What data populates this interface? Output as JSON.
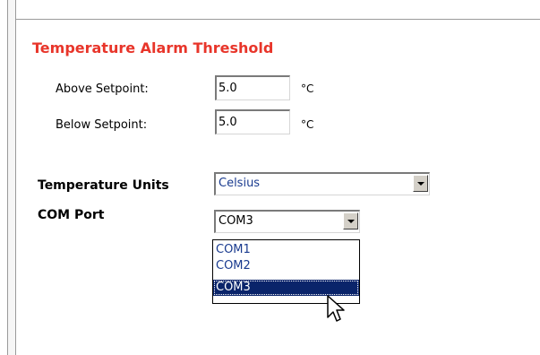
{
  "alarm": {
    "title": "Temperature Alarm Threshold",
    "above_label": "Above Setpoint:",
    "above_value": "5.0",
    "below_label": "Below Setpoint:",
    "below_value": "5.0",
    "unit": "°C"
  },
  "units": {
    "label": "Temperature Units",
    "selected": "Celsius"
  },
  "com_port": {
    "label": "COM Port",
    "selected": "COM3",
    "options": [
      "COM1",
      "COM2",
      "COM3"
    ],
    "highlighted_index": 2
  },
  "icons": [
    "dropdown-arrow-icon",
    "mouse-pointer-icon"
  ]
}
